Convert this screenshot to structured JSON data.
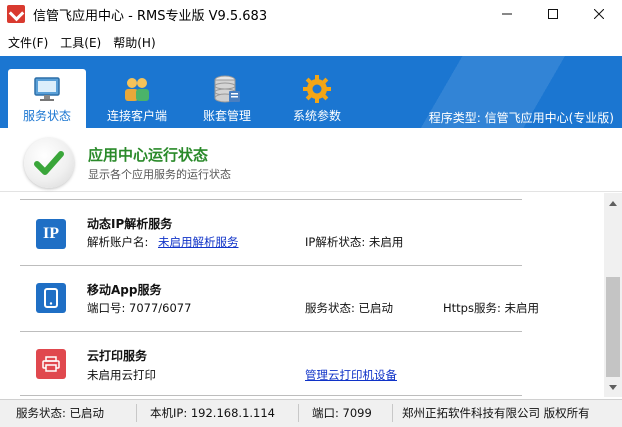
{
  "window": {
    "title": "信管飞应用中心 - RMS专业版 V9.5.683",
    "controls": [
      "minimize",
      "maximize",
      "close"
    ]
  },
  "menu": {
    "items": [
      "文件(F)",
      "工具(E)",
      "帮助(H)"
    ]
  },
  "toolbar": {
    "tabs": [
      {
        "label": "服务状态",
        "icon": "monitor-icon",
        "active": true
      },
      {
        "label": "连接客户端",
        "icon": "users-icon",
        "active": false
      },
      {
        "label": "账套管理",
        "icon": "database-icon",
        "active": false
      },
      {
        "label": "系统参数",
        "icon": "gear-icon",
        "active": false
      }
    ],
    "program_type": "程序类型: 信管飞应用中心(专业版)",
    "accent": "#1b76d1"
  },
  "header": {
    "title": "应用中心运行状态",
    "subtitle": "显示各个应用服务的运行状态",
    "icon": "checkmark-icon"
  },
  "services": [
    {
      "name": "动态IP解析服务",
      "icon": "ip-icon",
      "icon_text": "IP",
      "icon_color": "#1f6fc5",
      "fields": {
        "account_label": "解析账户名:",
        "account_link": "未启用解析服务",
        "ip_status": "IP解析状态: 未启用"
      }
    },
    {
      "name": "移动App服务",
      "icon": "mobile-icon",
      "icon_color": "#1f6fc5",
      "fields": {
        "port": "端口号: 7077/6077",
        "status": "服务状态: 已启动",
        "https": "Https服务: 未启用"
      }
    },
    {
      "name": "云打印服务",
      "icon": "printer-icon",
      "icon_color": "#e0484e",
      "fields": {
        "status": "未启用云打印",
        "manage_link": "管理云打印机设备"
      }
    }
  ],
  "statusbar": {
    "service_status": "服务状态: 已启动",
    "local_ip": "本机IP: 192.168.1.114",
    "port": "端口: 7099",
    "copyright": "郑州正拓软件科技有限公司 版权所有"
  }
}
